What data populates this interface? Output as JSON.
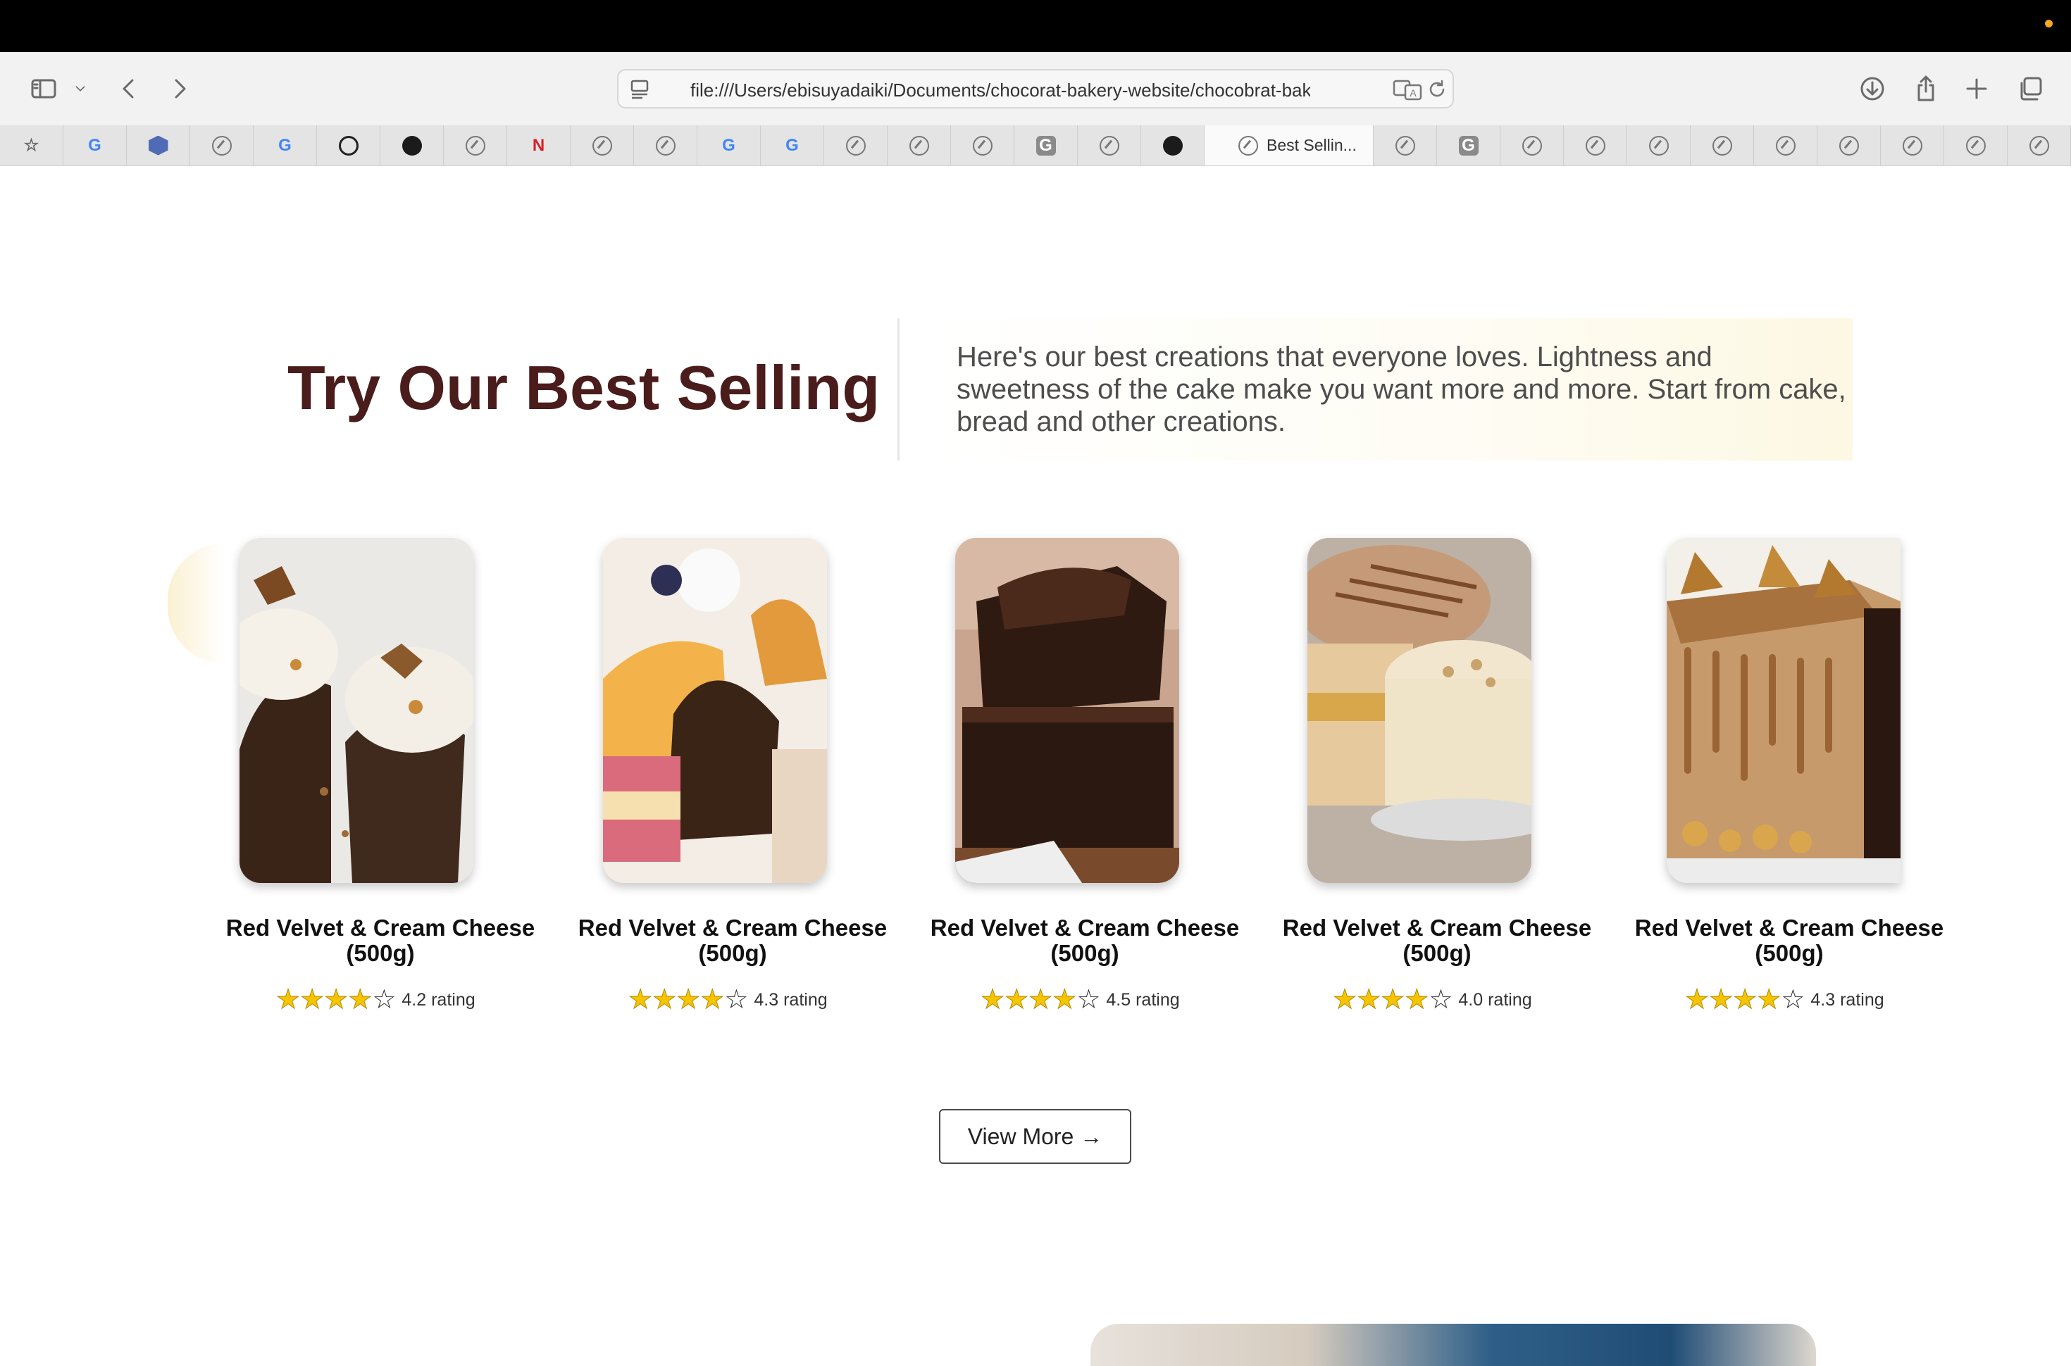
{
  "browser": {
    "url": "file:///Users/ebisuyadaiki/Documents/chocorat-bakery-website/chocobrat-bakery",
    "active_tab_title": "Best Sellin...",
    "tabs": [
      {
        "icon": "star-icon"
      },
      {
        "icon": "google-icon",
        "glyph": "G"
      },
      {
        "icon": "hexagon-icon"
      },
      {
        "icon": "compass-icon"
      },
      {
        "icon": "google-icon",
        "glyph": "G"
      },
      {
        "icon": "openai-icon"
      },
      {
        "icon": "github-icon"
      },
      {
        "icon": "compass-icon"
      },
      {
        "icon": "netflix-icon",
        "glyph": "N"
      },
      {
        "icon": "compass-icon"
      },
      {
        "icon": "compass-icon"
      },
      {
        "icon": "google-icon",
        "glyph": "G"
      },
      {
        "icon": "google-icon",
        "glyph": "G"
      },
      {
        "icon": "compass-icon"
      },
      {
        "icon": "compass-icon"
      },
      {
        "icon": "compass-icon"
      },
      {
        "icon": "grammarly-icon",
        "glyph": "G"
      },
      {
        "icon": "compass-icon"
      },
      {
        "icon": "github-icon"
      },
      {
        "icon": "active"
      },
      {
        "icon": "compass-icon"
      },
      {
        "icon": "grammarly-icon",
        "glyph": "G"
      },
      {
        "icon": "compass-icon"
      },
      {
        "icon": "compass-icon"
      },
      {
        "icon": "compass-icon"
      },
      {
        "icon": "compass-icon"
      },
      {
        "icon": "compass-icon"
      },
      {
        "icon": "compass-icon"
      },
      {
        "icon": "compass-icon"
      },
      {
        "icon": "compass-icon"
      },
      {
        "icon": "compass-icon"
      }
    ]
  },
  "section": {
    "heading": "Try Our Best Selling",
    "description": "Here's our best creations that everyone loves. Lightness and sweetness of the cake make you want more and more. Start from cake, bread and other creations."
  },
  "products": [
    {
      "name": "Red Velvet & Cream Cheese (500g)",
      "rating_value": 4.2,
      "rating_text": "4.2 rating",
      "image": "cupcakes-photo"
    },
    {
      "name": "Red Velvet & Cream Cheese (500g)",
      "rating_value": 4.3,
      "rating_text": "4.3 rating",
      "image": "pastries-photo"
    },
    {
      "name": "Red Velvet & Cream Cheese (500g)",
      "rating_value": 4.5,
      "rating_text": "4.5 rating",
      "image": "brownies-photo"
    },
    {
      "name": "Red Velvet & Cream Cheese (500g)",
      "rating_value": 4.0,
      "rating_text": "4.0 rating",
      "image": "cheesecakes-photo"
    },
    {
      "name": "Red Velvet & Cream Cheese (500g)",
      "rating_value": 4.3,
      "rating_text": "4.3 rating",
      "image": "caramel-cake-photo"
    }
  ],
  "stars_filled": 4,
  "stars_total": 5,
  "view_more_label": "View More →",
  "colors": {
    "heading": "#4a1c1c",
    "star_fill": "#f7c500",
    "accent_cream": "#fdf8e3"
  }
}
